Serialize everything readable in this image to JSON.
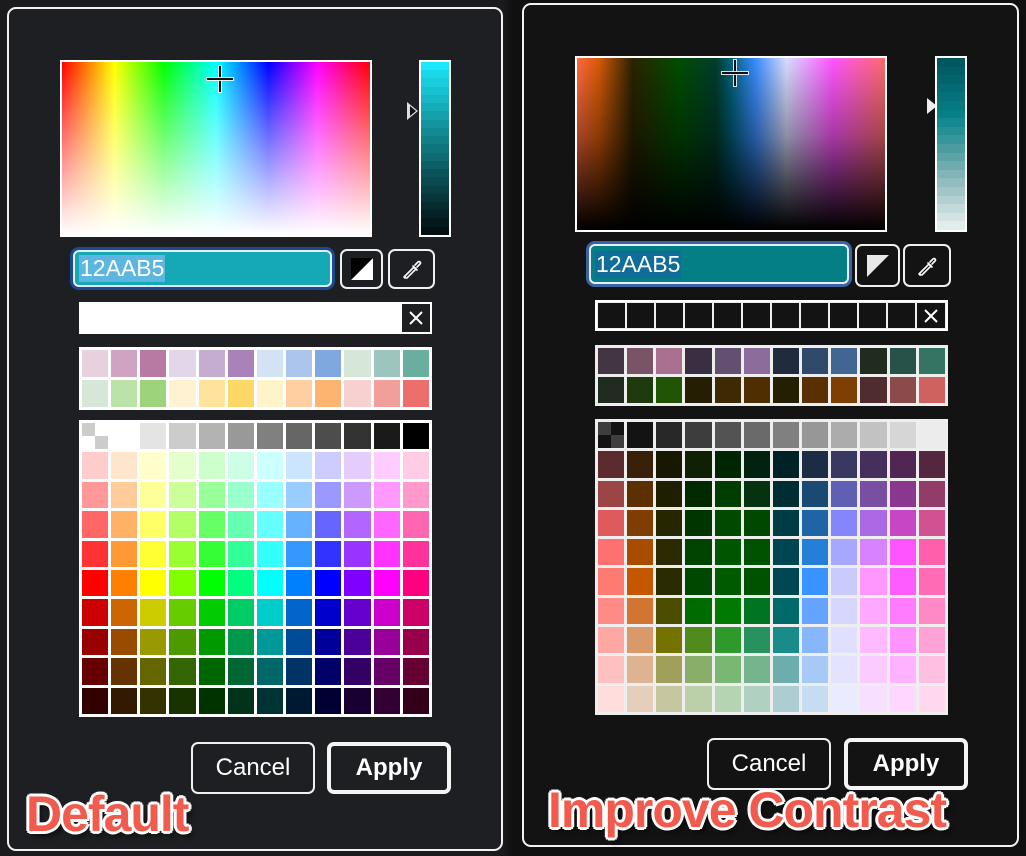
{
  "panels": [
    {
      "id": "default",
      "caption": "Default",
      "background": "#1e1f22",
      "hex_value": "12AAB5",
      "hex_fill": "#14a9b5",
      "hex_selection": "#5cb6e0",
      "hex_focus_ring": "#1b4a91",
      "crosshair_pos": {
        "h": 0.51,
        "s": 0.9
      },
      "value_slider_level": 0.71,
      "value_strip": [
        "#1be8fb",
        "#1ad8ea",
        "#19ccdc",
        "#18c1d0",
        "#17b6c4",
        "#16abb8",
        "#15a0ac",
        "#1395a0",
        "#128a94",
        "#117f88",
        "#10747c",
        "#0f6a71",
        "#0d5f66",
        "#0c545b",
        "#0a4a50",
        "#094045",
        "#07363a",
        "#062c30",
        "#042226",
        "#03191c",
        "#021012"
      ],
      "contrast_icon": "contrast-icon",
      "eyedropper_icon": "eyedropper-icon",
      "recent_colors": {
        "slots": [
          "#ffffff",
          "#ffffff",
          "#ffffff",
          "#ffffff",
          "#ffffff",
          "#ffffff",
          "#ffffff",
          "#ffffff",
          "#ffffff",
          "#ffffff",
          "#ffffff"
        ],
        "clear_icon": "close-icon",
        "border": "#ffffff",
        "clear_bg": "#1e1f22"
      },
      "custom_palette": [
        [
          "#e7d1de",
          "#cfa3c1",
          "#b87aa2",
          "#e2d6e8",
          "#c4adcf",
          "#a882b9",
          "#d3e2f4",
          "#abc5ec",
          "#7fa8df",
          "#d6e6d7",
          "#9bc5bd",
          "#6aaea0"
        ],
        [
          "#d6e6d7",
          "#bce3a7",
          "#9dd37b",
          "#fff2d2",
          "#ffe39a",
          "#fed866",
          "#fff4c9",
          "#ffcea1",
          "#feb471",
          "#f7d1d0",
          "#f29f9b",
          "#ec6f6b"
        ]
      ],
      "palette_border": "#ffffff",
      "swatch_grid": [
        [
          "transparent",
          "#ffffff",
          "#e4e4e4",
          "#cccccc",
          "#b3b3b3",
          "#999999",
          "#808080",
          "#666666",
          "#4d4d4d",
          "#333333",
          "#1a1a1a",
          "#000000"
        ],
        [
          "#ffcccc",
          "#ffe5cc",
          "#ffffcc",
          "#e5ffcc",
          "#ccffcc",
          "#ccffe5",
          "#ccffff",
          "#cce5ff",
          "#ccccff",
          "#e5ccff",
          "#ffccff",
          "#ffcce5"
        ],
        [
          "#ff9999",
          "#ffcc99",
          "#ffff99",
          "#ccff99",
          "#99ff99",
          "#99ffcc",
          "#99ffff",
          "#99ccff",
          "#9999ff",
          "#cc99ff",
          "#ff99ff",
          "#ff99cc"
        ],
        [
          "#ff6666",
          "#ffb266",
          "#ffff66",
          "#b2ff66",
          "#66ff66",
          "#66ffb2",
          "#66ffff",
          "#66b2ff",
          "#6666ff",
          "#b266ff",
          "#ff66ff",
          "#ff66b2"
        ],
        [
          "#ff3333",
          "#ff9933",
          "#ffff33",
          "#99ff33",
          "#33ff33",
          "#33ff99",
          "#33ffff",
          "#3399ff",
          "#3333ff",
          "#9933ff",
          "#ff33ff",
          "#ff3399"
        ],
        [
          "#ff0000",
          "#ff8000",
          "#ffff00",
          "#80ff00",
          "#00ff00",
          "#00ff80",
          "#00ffff",
          "#0080ff",
          "#0000ff",
          "#8000ff",
          "#ff00ff",
          "#ff0080"
        ],
        [
          "#cc0000",
          "#cc6600",
          "#cccc00",
          "#66cc00",
          "#00cc00",
          "#00cc66",
          "#00cccc",
          "#0066cc",
          "#0000cc",
          "#6600cc",
          "#cc00cc",
          "#cc0066"
        ],
        [
          "#990000",
          "#994c00",
          "#999900",
          "#4c9900",
          "#009900",
          "#00994c",
          "#009999",
          "#004c99",
          "#000099",
          "#4c0099",
          "#990099",
          "#99004c"
        ],
        [
          "#660000",
          "#663300",
          "#666600",
          "#336600",
          "#006600",
          "#006633",
          "#006666",
          "#003366",
          "#000066",
          "#330066",
          "#660066",
          "#660033"
        ],
        [
          "#330000",
          "#331900",
          "#333300",
          "#193300",
          "#003300",
          "#003319",
          "#003333",
          "#001933",
          "#000033",
          "#190033",
          "#330033",
          "#330019"
        ]
      ],
      "checker": [
        "#ffffff",
        "#cccccc"
      ],
      "buttons": {
        "cancel": "Cancel",
        "apply": "Apply"
      }
    },
    {
      "id": "contrast",
      "caption": "Improve Contrast",
      "background": "#131313",
      "hex_value": "12AAB5",
      "hex_fill": "#047f85",
      "hex_selection": "#106d98",
      "hex_focus_ring": "#3b63a6",
      "crosshair_pos": {
        "h": 0.51,
        "s": 0.9
      },
      "value_slider_level": 0.27,
      "value_strip": [
        "#01575f",
        "#025e66",
        "#03646c",
        "#046b73",
        "#057179",
        "#067880",
        "#078086",
        "#148a90",
        "#268f93",
        "#379699",
        "#4a9c9f",
        "#5ca3a6",
        "#6eabad",
        "#80b4b6",
        "#91bdbf",
        "#a2c6c8",
        "#b2d0d1",
        "#c3d9da",
        "#d3e3e3",
        "#e2eced"
      ],
      "contrast_icon": "contrast-icon",
      "eyedropper_icon": "eyedropper-icon",
      "recent_colors": {
        "slots": [
          "#131313",
          "#131313",
          "#131313",
          "#131313",
          "#131313",
          "#131313",
          "#131313",
          "#131313",
          "#131313",
          "#131313",
          "#131313"
        ],
        "clear_icon": "close-icon",
        "border": "#eeeeee",
        "clear_bg": "#131313"
      },
      "custom_palette": [
        [
          "#433542",
          "#785466",
          "#a97090",
          "#3a2e42",
          "#634f6f",
          "#8c6c9a",
          "#202c3e",
          "#2f4a6b",
          "#416694",
          "#202c1f",
          "#27524a",
          "#357463"
        ],
        [
          "#1f2c1f",
          "#1d3b0d",
          "#215404",
          "#261e02",
          "#3e2a02",
          "#4f2e02",
          "#241f02",
          "#5a3002",
          "#7f3f02",
          "#4f2c2d",
          "#8c4a4a",
          "#cf625e"
        ]
      ],
      "palette_border": "#eeeeee",
      "swatch_grid": [
        [
          "checker",
          "#131313",
          "#282828",
          "#3d3d3d",
          "#535353",
          "#6a6a6a",
          "#808080",
          "#979797",
          "#acacac",
          "#c2c2c2",
          "#d6d6d6",
          "#ececec"
        ],
        [
          "#5b2b30",
          "#38200a",
          "#181801",
          "#0f2102",
          "#002502",
          "#00220f",
          "#002126",
          "#1c2c45",
          "#383862",
          "#462f5c",
          "#512652",
          "#54273f"
        ],
        [
          "#9c4546",
          "#5c3000",
          "#1f1f00",
          "#002900",
          "#003d00",
          "#043310",
          "#002c34",
          "#1a4a74",
          "#5f5fb3",
          "#784fa3",
          "#8b3790",
          "#933c6a"
        ],
        [
          "#de5a5c",
          "#7f3e00",
          "#262600",
          "#003500",
          "#004a00",
          "#004700",
          "#003c46",
          "#1f65a6",
          "#8686fc",
          "#a96ae4",
          "#c746c6",
          "#d15292"
        ],
        [
          "#ff7070",
          "#a84d00",
          "#2b2a00",
          "#004400",
          "#005600",
          "#005200",
          "#004552",
          "#247fd6",
          "#a6a8ff",
          "#d783ff",
          "#ff54ff",
          "#ff5fab"
        ],
        [
          "#ff7a70",
          "#c55700",
          "#2b2b00",
          "#004800",
          "#005b00",
          "#005200",
          "#004753",
          "#3993ff",
          "#c9cbff",
          "#ff97ff",
          "#ff5cff",
          "#ff6bb4"
        ],
        [
          "#ff8b87",
          "#d27532",
          "#4d4d00",
          "#006b00",
          "#007b00",
          "#007420",
          "#006a6b",
          "#64a3fe",
          "#d6d6ff",
          "#ffa8ff",
          "#ff7cff",
          "#ff88c6"
        ],
        [
          "#ffa8a3",
          "#d99968",
          "#757300",
          "#4f8c1d",
          "#2e9a2c",
          "#27925d",
          "#1a8b8b",
          "#86b6fb",
          "#dfdfff",
          "#ffbaff",
          "#ff93ff",
          "#ffa3d7"
        ],
        [
          "#ffc1c0",
          "#deb391",
          "#a0a05a",
          "#88ae69",
          "#79b872",
          "#76b48e",
          "#6cadae",
          "#a6c9f5",
          "#e3e3ff",
          "#fbcbff",
          "#ffb2ff",
          "#ffbfe2"
        ],
        [
          "#ffdddd",
          "#e6cfba",
          "#c6c6a1",
          "#bbcfa8",
          "#b4d4b2",
          "#b0d1c2",
          "#acced2",
          "#c6dcf0",
          "#ebebff",
          "#f7e0ff",
          "#ffd6ff",
          "#ffd8ed"
        ]
      ],
      "checker": [
        "#131313",
        "#3e3e3e"
      ],
      "buttons": {
        "cancel": "Cancel",
        "apply": "Apply"
      }
    }
  ]
}
